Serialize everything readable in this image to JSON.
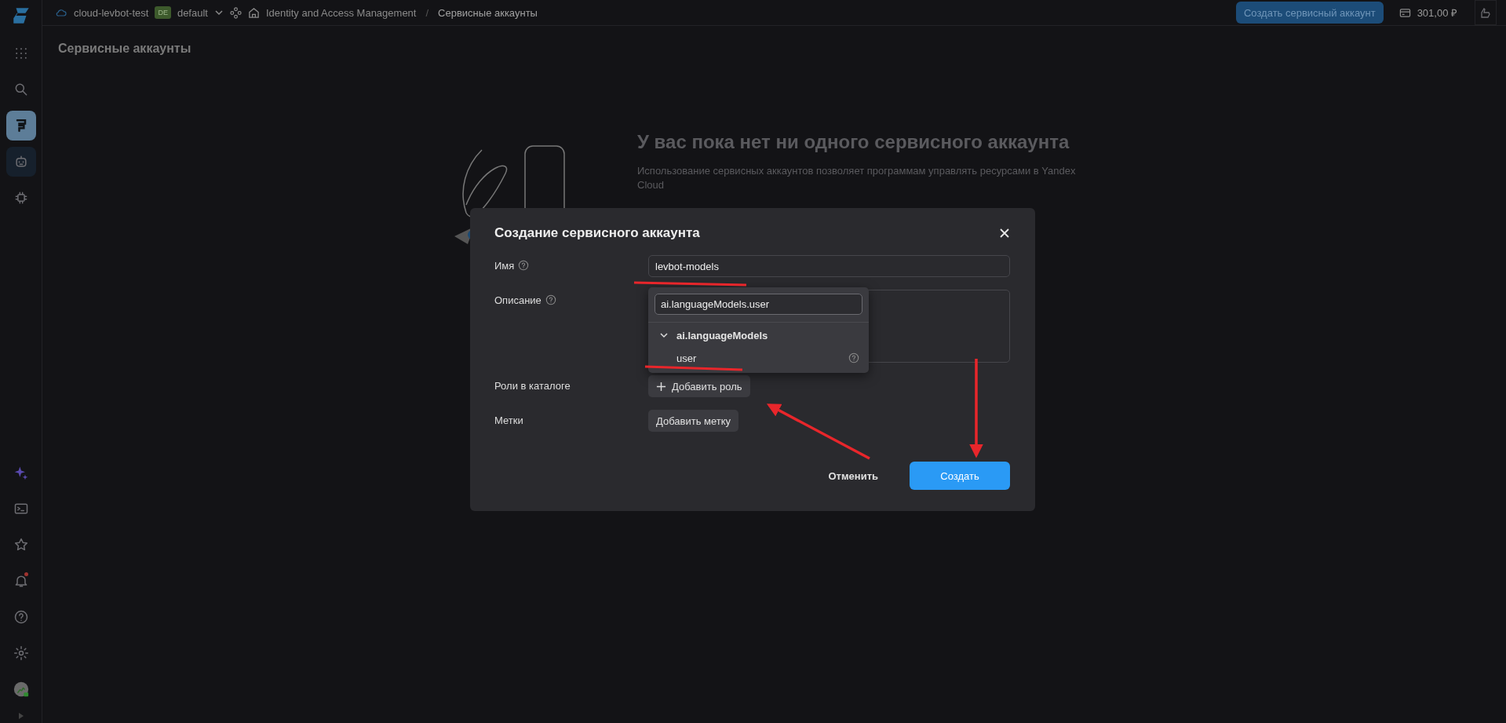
{
  "top_bar": {
    "project": "cloud-levbot-test",
    "folder_badge": "DE",
    "folder": "default",
    "breadcrumbs": [
      "Identity and Access Management",
      "Сервисные аккаунты"
    ],
    "separator": "/",
    "create_button": "Создать сервисный аккаунт",
    "balance": "301,00 ₽"
  },
  "sidebar": {
    "items": [
      {
        "kind": "grid",
        "selected": false,
        "hovered": false,
        "alert": false
      },
      {
        "kind": "search",
        "selected": false,
        "hovered": false,
        "alert": false
      },
      {
        "kind": "service",
        "selected": true,
        "hovered": false,
        "alert": false
      },
      {
        "kind": "robot",
        "selected": false,
        "hovered": true,
        "alert": false
      },
      {
        "kind": "chip",
        "selected": false,
        "hovered": false,
        "alert": false
      }
    ],
    "bottom_items": [
      {
        "kind": "sparkle",
        "selected": false,
        "hovered": false,
        "alert": false
      },
      {
        "kind": "terminal",
        "selected": false,
        "hovered": false,
        "alert": false
      },
      {
        "kind": "star",
        "selected": false,
        "hovered": false,
        "alert": false
      },
      {
        "kind": "bell",
        "selected": false,
        "hovered": false,
        "alert": true
      },
      {
        "kind": "help",
        "selected": false,
        "hovered": false,
        "alert": false
      },
      {
        "kind": "gear",
        "selected": false,
        "hovered": false,
        "alert": false
      },
      {
        "kind": "avatar",
        "selected": false,
        "hovered": false,
        "alert": false
      }
    ]
  },
  "page_title": "Сервисные аккаунты",
  "empty_state": {
    "title": "У вас пока нет ни одного сервисного аккаунта",
    "text": "Использование сервисных аккаунтов позволяет программам управлять ресурсами в Yandex Cloud"
  },
  "dialog": {
    "title": "Создание сервисного аккаунта",
    "fields": [
      {
        "kind": "input",
        "label": "Имя",
        "help": true,
        "value": "levbot-models"
      },
      {
        "kind": "textarea",
        "label": "Описание",
        "help": true
      },
      {
        "kind": "plus_button",
        "label": "Роли в каталоге",
        "help": false,
        "button": "Добавить роль"
      },
      {
        "kind": "button",
        "label": "Метки",
        "help": false,
        "button": "Добавить метку"
      }
    ],
    "dropdown": {
      "search": "ai.languageModels.user",
      "groups": [
        {
          "name": "ai.languageModels",
          "expanded": true,
          "children": [
            {
              "name": "user",
              "help": true
            }
          ]
        }
      ]
    },
    "cancel": "Отменить",
    "submit": "Создать"
  }
}
